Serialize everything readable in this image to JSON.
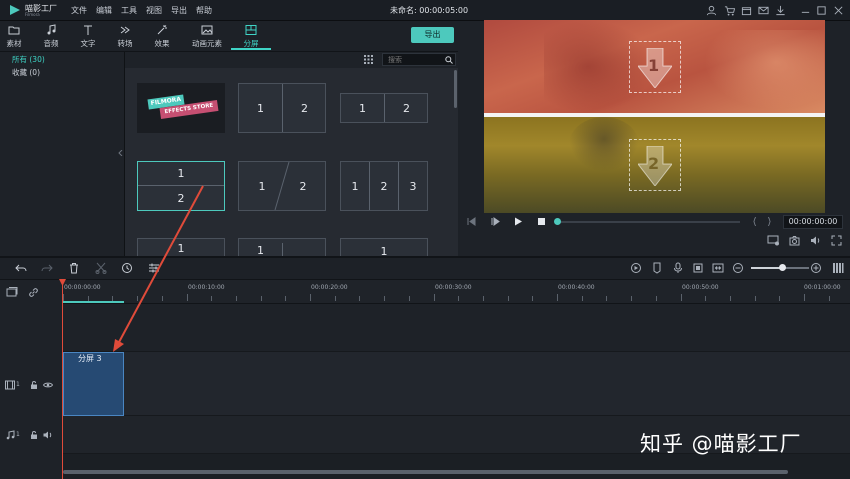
{
  "app": {
    "name": "喵影工厂",
    "sub": "Filmora",
    "doc_title": "未命名: 00:00:05:00"
  },
  "menu": [
    "文件",
    "编辑",
    "工具",
    "视图",
    "导出",
    "帮助"
  ],
  "toolbar": {
    "tabs": [
      {
        "label": "素材",
        "icon": "folder-icon"
      },
      {
        "label": "音频",
        "icon": "music-note-icon"
      },
      {
        "label": "文字",
        "icon": "text-icon"
      },
      {
        "label": "转场",
        "icon": "transition-icon"
      },
      {
        "label": "效果",
        "icon": "effects-icon"
      },
      {
        "label": "动画元素",
        "icon": "image-icon"
      },
      {
        "label": "分屏",
        "icon": "split-screen-icon",
        "active": true
      }
    ],
    "export_label": "导出"
  },
  "library": {
    "categories": [
      {
        "label": "所有 (30)",
        "active": true
      },
      {
        "label": "收藏 (0)"
      }
    ],
    "search_placeholder": "搜索",
    "store_text_1": "FILMORA",
    "store_text_2": "EFFECTS STORE",
    "thumb_numbers": {
      "one": "1",
      "two": "2",
      "three": "3"
    }
  },
  "preview": {
    "timecode": "00:00:00:00",
    "progress": 0,
    "overlay_numbers": [
      "1",
      "2"
    ]
  },
  "timeline": {
    "ruler": [
      "00:00:00:00",
      "00:00:10:00",
      "00:00:20:00",
      "00:00:30:00",
      "00:00:40:00",
      "00:00:50:00",
      "00:01:00:00"
    ],
    "clip_label": "分屏 3",
    "video_track": "1",
    "audio_track": "1",
    "zoom_level": 0.5
  },
  "watermark": "知乎 @喵影工厂",
  "colors": {
    "accent": "#4dc9bd",
    "playhead": "#e04b3a",
    "clip": "#264a73"
  }
}
